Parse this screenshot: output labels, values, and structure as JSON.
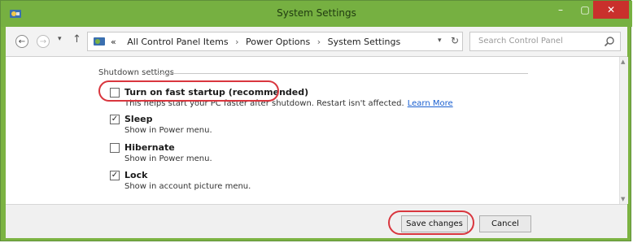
{
  "window": {
    "title": "System Settings",
    "minimize": "–",
    "maximize": "▢",
    "close": "✕"
  },
  "nav": {
    "back": "←",
    "forward": "→",
    "recent": "▾",
    "up": "↑"
  },
  "address": {
    "prefix": "«",
    "crumbs": [
      "All Control Panel Items",
      "Power Options",
      "System Settings"
    ],
    "separator": "›",
    "dropdown": "▾",
    "refresh": "↻"
  },
  "search": {
    "placeholder": "Search Control Panel"
  },
  "shutdown": {
    "group_label": "Shutdown settings",
    "options": [
      {
        "label": "Turn on fast startup (recommended)",
        "checked": false,
        "description": "This helps start your PC faster after shutdown. Restart isn't affected.",
        "link": "Learn More"
      },
      {
        "label": "Sleep",
        "checked": true,
        "description": "Show in Power menu."
      },
      {
        "label": "Hibernate",
        "checked": false,
        "description": "Show in Power menu."
      },
      {
        "label": "Lock",
        "checked": true,
        "description": "Show in account picture menu."
      }
    ]
  },
  "footer": {
    "save_label": "Save changes",
    "cancel_label": "Cancel"
  },
  "colors": {
    "titlebar": "#76b041",
    "close": "#c9302c",
    "highlight": "#d9363e",
    "link": "#1a5fd0"
  },
  "icons": {
    "app": "control-panel-icon",
    "search": "magnifier-icon"
  }
}
